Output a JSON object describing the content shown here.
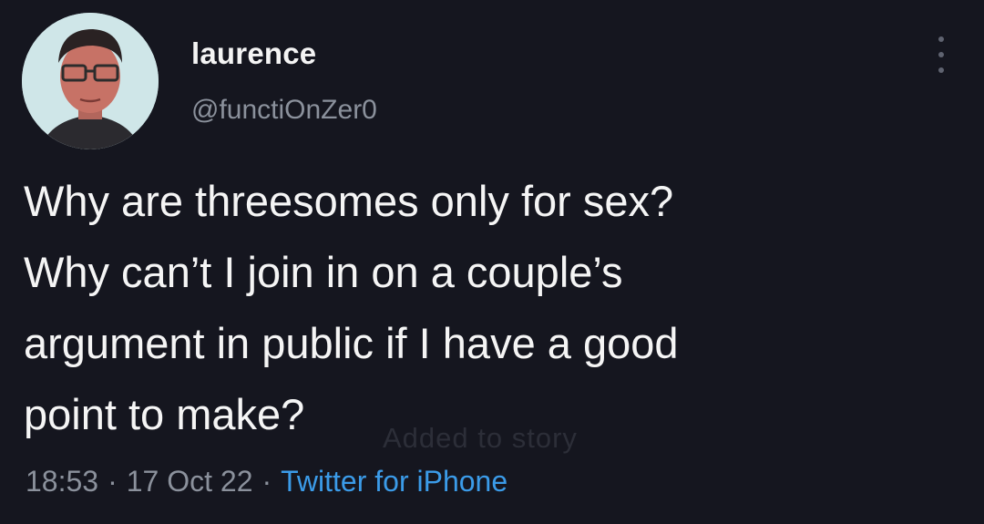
{
  "tweet": {
    "display_name": "laurence",
    "handle": "@functiOnZer0",
    "text_lines": [
      "Why are threesomes only for sex?",
      "Why can’t I join in on a couple’s",
      "argument in public if I have a good",
      "point to make?"
    ],
    "watermark": "Added to story",
    "time": "18:53",
    "separator": "·",
    "date": "17 Oct 22",
    "source": "Twitter for iPhone",
    "more_icon": "vertical-ellipsis-icon",
    "colors": {
      "background": "#15161f",
      "text": "#f5f5f5",
      "secondary": "#8b919c",
      "link": "#3b9be8"
    }
  }
}
